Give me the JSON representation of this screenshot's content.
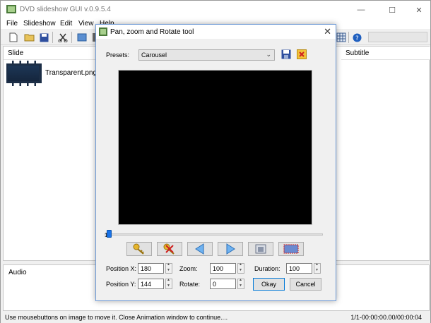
{
  "app": {
    "title": "DVD slideshow GUI v.0.9.5.4",
    "window_controls": {
      "minimize": "—",
      "maximize": "☐",
      "close": "✕"
    }
  },
  "menu": [
    "File",
    "Slideshow",
    "Edit",
    "View",
    "Help"
  ],
  "toolbar": {
    "icons": [
      "new-icon",
      "open-folder-icon",
      "save-icon",
      "cut-icon",
      "preview-icon",
      "movie-icon",
      "grid-icon",
      "help-icon"
    ]
  },
  "slides": {
    "columns": {
      "slide": "Slide",
      "subtitle": "Subtitle"
    },
    "items": [
      {
        "name": "Transparent.png"
      }
    ]
  },
  "audio": {
    "label": "Audio"
  },
  "status": {
    "message": "Use mousebuttons on image to move it. Close Animation window to continue....",
    "position": "1/1-00:00:00.00/00:00:04"
  },
  "dialog": {
    "title": "Pan, zoom and Rotate tool",
    "close": "✕",
    "presets_label": "Presets:",
    "preset_value": "Carousel",
    "slider_value": "1",
    "fields": {
      "position_x": {
        "label": "Position X:",
        "value": "180"
      },
      "position_y": {
        "label": "Position Y:",
        "value": "144"
      },
      "zoom": {
        "label": "Zoom:",
        "value": "100"
      },
      "rotate": {
        "label": "Rotate:",
        "value": "0"
      },
      "duration": {
        "label": "Duration:",
        "value": "100"
      }
    },
    "buttons": {
      "okay": "Okay",
      "cancel": "Cancel"
    },
    "colors": {
      "accent": "#1a73e8",
      "preview_bg": "#000000"
    }
  }
}
